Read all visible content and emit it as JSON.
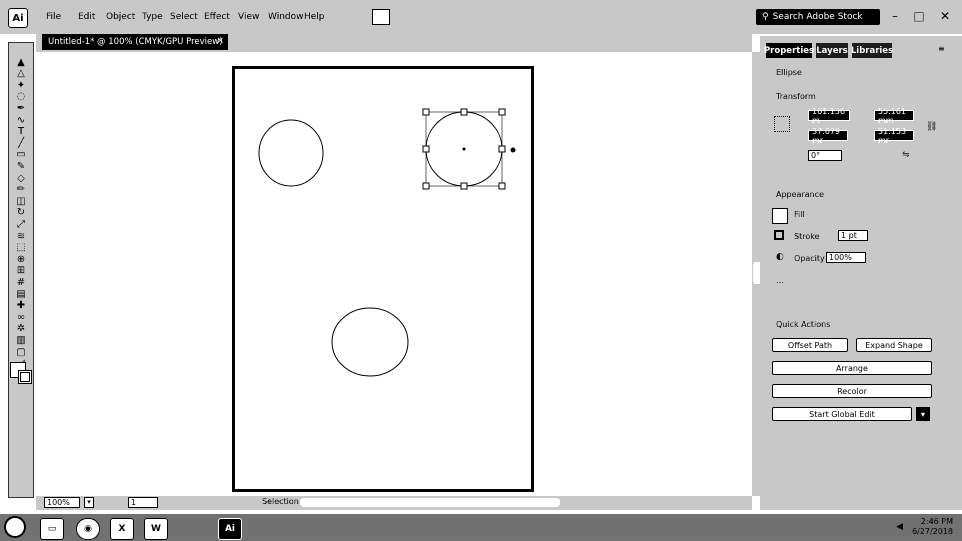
{
  "app": {
    "logo_text": "Ai",
    "menus": [
      "File",
      "Edit",
      "Object",
      "Type",
      "Select",
      "Effect",
      "View",
      "Window",
      "Help"
    ],
    "search_placeholder": "Search Adobe Stock",
    "window_controls": [
      "–",
      "□",
      "✕"
    ]
  },
  "document": {
    "tab_title": "Untitled-1* @ 100% (CMYK/GPU Preview)",
    "tab_close": "×"
  },
  "toolbar": {
    "tools": [
      "selection-tool",
      "direct-selection-tool",
      "magic-wand-tool",
      "lasso-tool",
      "pen-tool",
      "curvature-tool",
      "type-tool",
      "line-tool",
      "rectangle-tool",
      "paintbrush-tool",
      "shaper-tool",
      "pencil-tool",
      "eraser-tool",
      "rotate-tool",
      "scale-tool",
      "width-tool",
      "free-transform-tool",
      "shape-builder-tool",
      "perspective-tool",
      "mesh-tool",
      "gradient-tool",
      "eyedropper-tool",
      "blend-tool",
      "symbol-sprayer-tool",
      "column-graph-tool",
      "artboard-tool",
      "slice-tool",
      "hand-tool",
      "zoom-tool"
    ]
  },
  "status": {
    "zoom": "100%",
    "artboard": "1",
    "tool_name": "Selection"
  },
  "panel": {
    "tabs": [
      "Properties",
      "Layers",
      "Libraries"
    ],
    "selection_label": "Ellipse",
    "transform_label": "Transform",
    "x": "161.156 m",
    "y": "55.161 mm",
    "w": "37.679 mr",
    "h": "31.153 mr",
    "angle": "0°",
    "appearance_label": "Appearance",
    "fill_label": "Fill",
    "stroke_label": "Stroke",
    "stroke_value": "1 pt",
    "opacity_label": "Opacity",
    "opacity_value": "100%",
    "quick_actions_label": "Quick Actions",
    "buttons": {
      "offset_path": "Offset Path",
      "expand_shape": "Expand Shape",
      "arrange": "Arrange",
      "recolor": "Recolor",
      "start_global_edit": "Start Global Edit"
    }
  },
  "taskbar": {
    "apps": [
      "start",
      "explorer",
      "chrome",
      "excel",
      "word",
      "illustrator"
    ],
    "time": "2:46 PM",
    "date": "6/27/2018"
  }
}
